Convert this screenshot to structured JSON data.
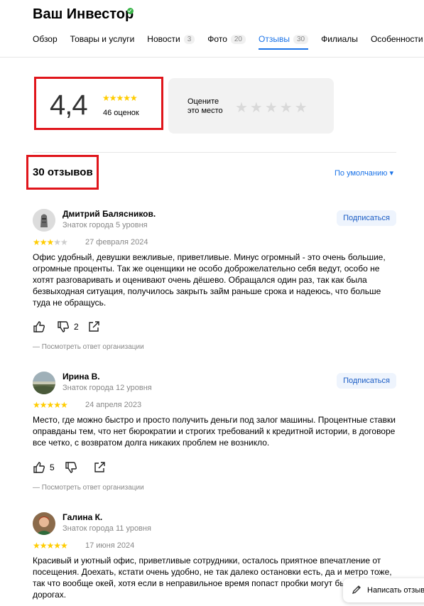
{
  "header": {
    "title": "Ваш Инвестор",
    "tabs": [
      {
        "label": "Обзор",
        "count": ""
      },
      {
        "label": "Товары и услуги",
        "count": ""
      },
      {
        "label": "Новости",
        "count": "3"
      },
      {
        "label": "Фото",
        "count": "20"
      },
      {
        "label": "Отзывы",
        "count": "30"
      },
      {
        "label": "Филиалы",
        "count": ""
      },
      {
        "label": "Особенности",
        "count": ""
      }
    ]
  },
  "summary": {
    "rating": "4,4",
    "stars": "★★★★★",
    "count": "46 оценок",
    "rate_label": "Оцените это место",
    "rate_stars": "★★★★★"
  },
  "reviews_header": {
    "title": "30 отзывов",
    "sort": "По умолчанию ▾"
  },
  "reviews": [
    {
      "name": "Дмитрий Балясников.",
      "level": "Знаток города 5 уровня",
      "subscribe": "Подписаться",
      "stars_on": "★★★",
      "stars_off": "★★",
      "rating": 3,
      "date": "27 февраля 2024",
      "text": "Офис удобный, девушки вежливые, приветливые. Минус огромный - это очень большие, огромные проценты. Так же оценщики не особо доброжелательно себя ведут, особо не хотят разговаривать и оценивают очень дёшево. Обращался один раз, так как была безвыходная ситуация, получилось закрыть займ раньше срока и надеюсь, что больше туда не обращусь.",
      "likes": "",
      "dislikes": "2",
      "answer": "— Посмотреть ответ организации"
    },
    {
      "name": "Ирина В.",
      "level": "Знаток города 12 уровня",
      "subscribe": "Подписаться",
      "stars_on": "★★★★★",
      "stars_off": "",
      "rating": 5,
      "date": "24 апреля 2023",
      "text": "Место, где можно быстро и просто получить деньги под залог машины. Процентные ставки оправданы тем, что нет бюрократии и строгих требований к кредитной истории, в договоре все четко, с возвратом долга никаких проблем не возникло.",
      "likes": "5",
      "dislikes": "",
      "answer": "— Посмотреть ответ организации"
    },
    {
      "name": "Галина К.",
      "level": "Знаток города 11 уровня",
      "stars_on": "★★★★★",
      "stars_off": "",
      "rating": 5,
      "date": "17 июня 2024",
      "text": "Красивый и уютный офис, приветливые сотрудники, осталось приятное впечатление от посещения. Доехать, кстати очень удобно, не так далеко остановки есть, да и метро тоже, так что вообще окей, хотя если в неправильное время попаст пробки могут быть на дорогах."
    }
  ],
  "write_review": "Написать отзыв",
  "colors": {
    "accent": "#1a73e8",
    "star": "#ffcc00",
    "highlight": "#e0151b"
  },
  "icons": [
    "verified-icon",
    "thumb-up-icon",
    "thumb-down-icon",
    "share-icon",
    "pencil-icon"
  ]
}
